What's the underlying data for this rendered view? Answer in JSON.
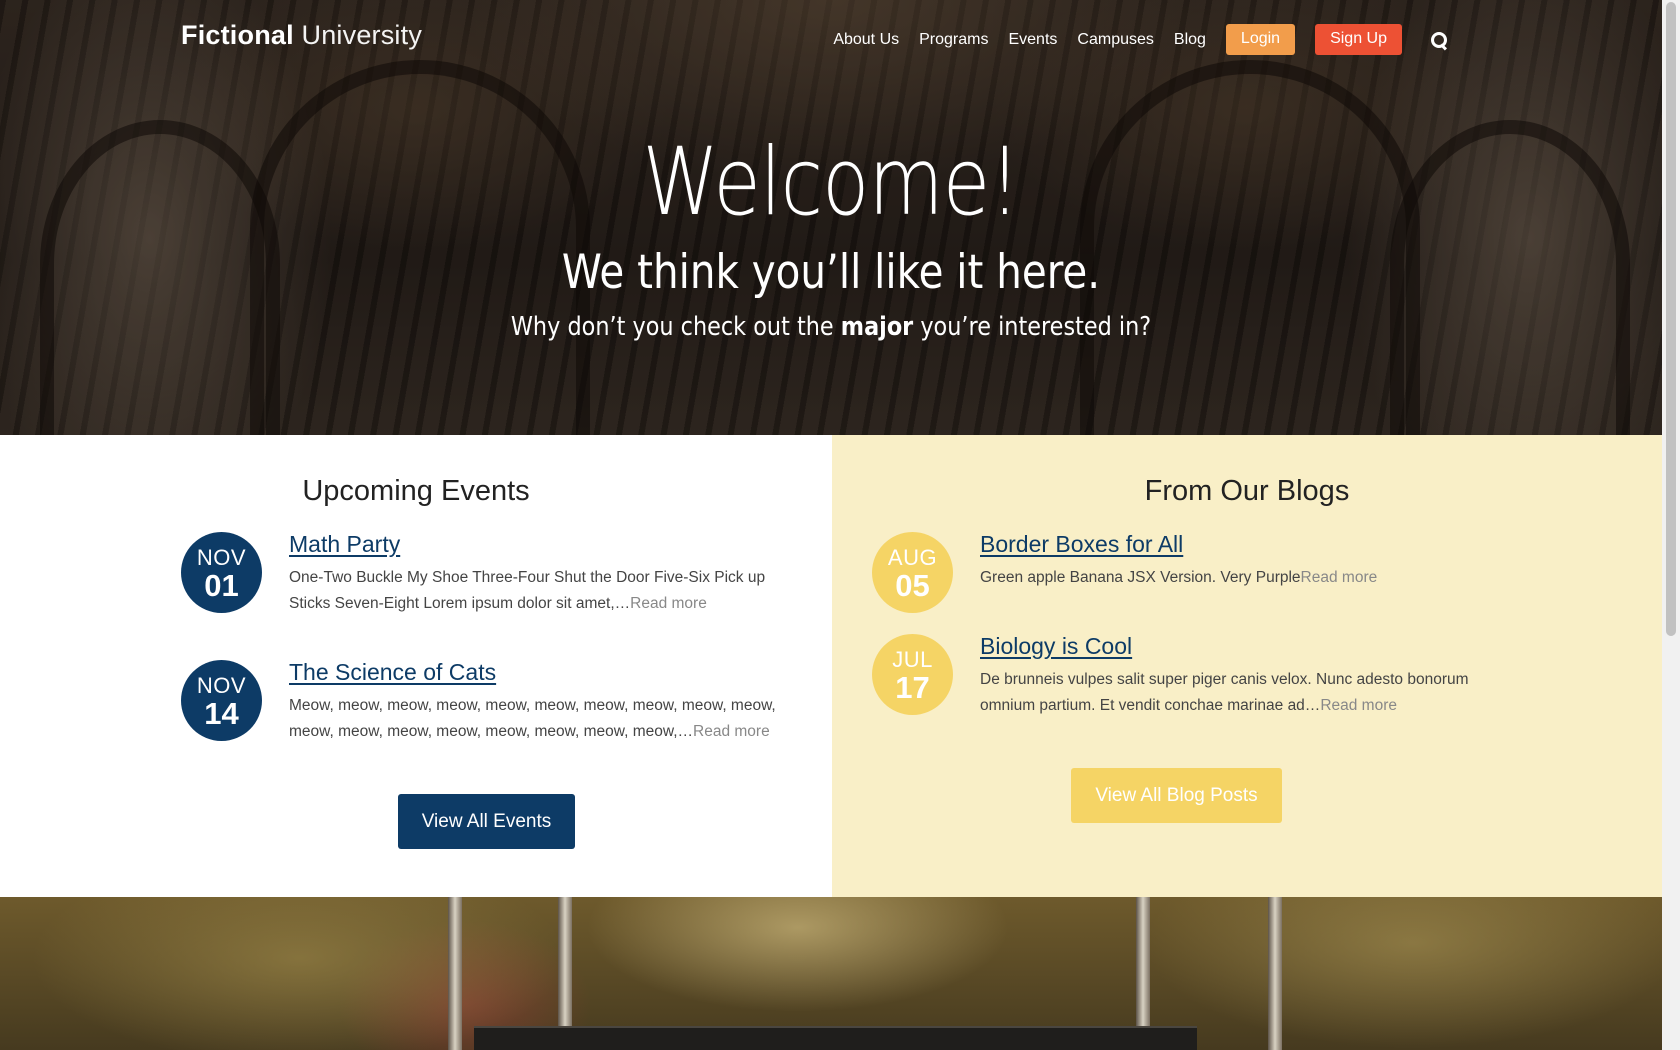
{
  "header": {
    "logo_bold": "Fictional",
    "logo_light": "University",
    "nav": [
      "About Us",
      "Programs",
      "Events",
      "Campuses",
      "Blog"
    ],
    "login_label": "Login",
    "signup_label": "Sign Up",
    "search_icon": "search-icon"
  },
  "hero": {
    "title": "Welcome!",
    "subtitle": "We think you’ll like it here.",
    "prompt_before": "Why don’t you check out the ",
    "prompt_bold": "major",
    "prompt_after": " you’re interested in?"
  },
  "events": {
    "heading": "Upcoming Events",
    "items": [
      {
        "month": "NOV",
        "day": "01",
        "title": "Math Party",
        "excerpt": "One-Two Buckle My Shoe Three-Four Shut the Door Five-Six Pick up Sticks Seven-Eight Lorem ipsum dolor sit amet,…",
        "read_more": "Read more"
      },
      {
        "month": "NOV",
        "day": "14",
        "title": "The Science of Cats",
        "excerpt": "Meow, meow, meow, meow, meow, meow, meow, meow, meow, meow, meow, meow, meow, meow, meow, meow, meow, meow,…",
        "read_more": "Read more"
      }
    ],
    "view_all_label": "View All Events"
  },
  "blogs": {
    "heading": "From Our Blogs",
    "items": [
      {
        "month": "AUG",
        "day": "05",
        "title": "Border Boxes for All",
        "excerpt": "Green apple Banana JSX Version. Very Purple",
        "read_more": "Read more"
      },
      {
        "month": "JUL",
        "day": "17",
        "title": "Biology is Cool",
        "excerpt": "De brunneis vulpes salit super piger canis velox. Nunc adesto bonorum omnium partium. Et vendit conchae marinae ad…",
        "read_more": "Read more"
      }
    ],
    "view_all_label": "View All Blog Posts"
  },
  "colors": {
    "navy": "#0d3b66",
    "yellow": "#f5d465",
    "cream": "#f9efc7",
    "login_orange": "#f29d4b",
    "signup_red": "#ed5134"
  }
}
